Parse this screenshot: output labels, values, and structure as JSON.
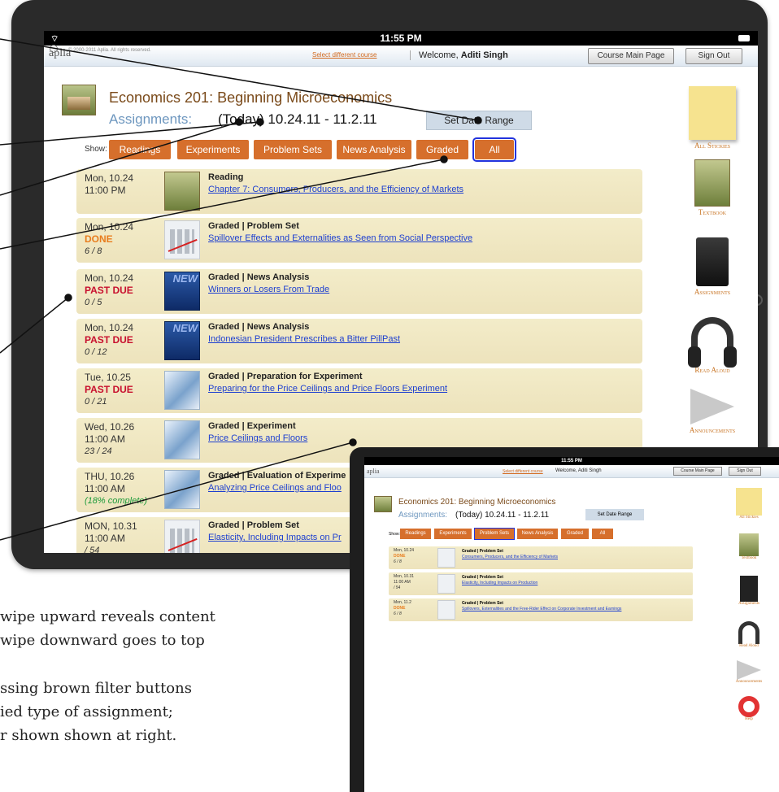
{
  "main_screen": {
    "status_bar": {
      "time": "11:55 PM"
    },
    "top_bar": {
      "logo": "aplia",
      "copyright": "© 2000-2011 Aplia. All rights reserved.",
      "select_course": "Select different course",
      "welcome_prefix": "Welcome,",
      "user_name": "Aditi Singh",
      "course_main_page": "Course Main Page",
      "sign_out": "Sign Out"
    },
    "course_title": "Economics 201: Beginning Microeconomics",
    "assignments_label": "Assignments:",
    "date_range": "(Today) 10.24.11 - 11.2.11",
    "set_date_range": "Set Date Range",
    "filters": {
      "show_label": "Show:",
      "buttons": [
        "Readings",
        "Experiments",
        "Problem Sets",
        "News Analysis",
        "Graded",
        "All"
      ],
      "selected": "All"
    },
    "assignments": [
      {
        "date": "Mon, 10.24",
        "time": "11:00 PM",
        "status": "",
        "score": "",
        "thumb": "reading",
        "type": "Reading",
        "title": "Chapter 7: Consumers, Producers, and the Efficiency of Markets"
      },
      {
        "date": "Mon, 10.24",
        "time": "",
        "status": "DONE",
        "score": "6 / 8",
        "thumb": "chart",
        "type": "Graded | Problem Set",
        "title": "Spillover Effects and Externalities as Seen from Social Perspective"
      },
      {
        "date": "Mon, 10.24",
        "time": "",
        "status": "PAST DUE",
        "score": "0 / 5",
        "thumb": "news",
        "type": "Graded | News Analysis",
        "title": "Winners or Losers From Trade"
      },
      {
        "date": "Mon, 10.24",
        "time": "",
        "status": "PAST DUE",
        "score": "0 / 12",
        "thumb": "news",
        "type": "Graded | News Analysis",
        "title": "Indonesian President Prescribes a Bitter PillPast"
      },
      {
        "date": "Tue, 10.25",
        "time": "",
        "status": "PAST DUE",
        "score": "0 / 21",
        "thumb": "exp",
        "type": "Graded | Preparation for Experiment",
        "title": "Preparing for the Price Ceilings and Price Floors Experiment"
      },
      {
        "date": "Wed, 10.26",
        "time": "11:00 AM",
        "status": "",
        "score": "23 / 24",
        "thumb": "exp",
        "type": "Graded | Experiment",
        "title": "Price Ceilings and Floors"
      },
      {
        "date": "THU, 10.26",
        "time": "11:00 AM",
        "status": "",
        "score": "(18% complete)",
        "thumb": "exp",
        "type": "Graded | Evaluation of Experime",
        "title": "Analyzing Price Ceilings and Floo"
      },
      {
        "date": "MON, 10.31",
        "time": "11:00 AM",
        "status": "",
        "score": " / 54",
        "thumb": "chart",
        "type": "Graded | Problem Set",
        "title": "Elasticity, Including Impacts on Pr"
      }
    ],
    "sidebar": [
      "All Stickies",
      "Textbook",
      "Assignments",
      "Read Aloud",
      "Announcements"
    ]
  },
  "inset_screen": {
    "status_bar": {
      "time": "11:55 PM"
    },
    "top_bar": {
      "logo": "aplia",
      "select_course": "Select different course",
      "welcome": "Welcome, Aditi Singh",
      "course_main_page": "Course Main Page",
      "sign_out": "Sign Out"
    },
    "course_title": "Economics 201: Beginning Microeconomics",
    "assignments_label": "Assignments:",
    "date_range": "(Today) 10.24.11 - 11.2.11",
    "set_date_range": "Set Date Range",
    "filters": {
      "show_label": "Show:",
      "buttons": [
        "Readings",
        "Experiments",
        "Problem Sets",
        "News Analysis",
        "Graded",
        "All"
      ],
      "selected": "Problem Sets"
    },
    "assignments": [
      {
        "date": "Mon, 10.24",
        "status": "DONE",
        "score": "6 / 8",
        "time": "",
        "type": "Graded | Problem Set",
        "title": "Consumers, Producers, and the Efficiency of Markets"
      },
      {
        "date": "Mon, 10.31",
        "status": "",
        "time": "11:00 AM",
        "score": " / 54",
        "type": "Graded | Problem Set",
        "title": "Elasticity, Including Impacts on Production"
      },
      {
        "date": "Mon, 11.2",
        "status": "DONE",
        "time": "",
        "score": "6 / 8",
        "type": "Graded | Problem Set",
        "title": "Spillovers, Externalities and the Free-Rider Effect on Corporate Investment and Earnings"
      }
    ],
    "sidebar": [
      "All Stickies",
      "Textbook",
      "Assignments",
      "Read Aloud",
      "Announcements",
      "Help"
    ]
  },
  "caption": {
    "line1": "wipe upward reveals content",
    "line2": "wipe downward goes to top",
    "line3": "ssing brown filter buttons",
    "line4": "ied type of assignment;",
    "line5": "r shown shown at right."
  }
}
